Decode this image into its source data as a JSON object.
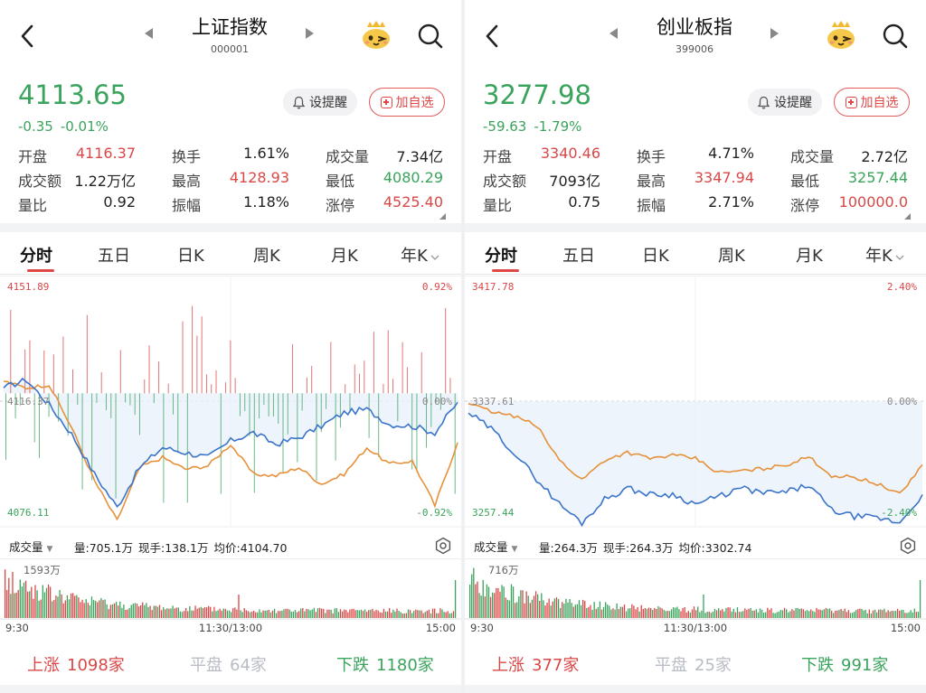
{
  "colors": {
    "up": "#d94747",
    "down": "#3aa35c",
    "price_line": "#3b74c8",
    "avg_line": "#e6913a",
    "flat": "#b8bcc4"
  },
  "icons": {
    "back": "chevron-left-icon",
    "prev": "triangle-left-icon",
    "next": "triangle-right-icon",
    "mascot": "mascot-icon",
    "search": "search-icon",
    "bell": "bell-icon",
    "add": "plus-box-icon",
    "gear": "gear-icon"
  },
  "buttons": {
    "alert_label": "设提醒",
    "add_label": "加自选"
  },
  "labels": {
    "open": "开盘",
    "turnover": "换手",
    "volume": "成交量",
    "amount": "成交额",
    "high": "最高",
    "low": "最低",
    "vol_ratio": "量比",
    "amplitude": "振幅",
    "limit_up": "涨停"
  },
  "tabs": [
    "分时",
    "五日",
    "日K",
    "周K",
    "月K",
    "年K"
  ],
  "axis_times": {
    "start": "9:30",
    "mid": "11:30/13:00",
    "end": "15:00"
  },
  "vol_dropdown_label": "成交量",
  "footer_labels": {
    "up": "上涨",
    "flat": "平盘",
    "down": "下跌"
  },
  "left": {
    "title": "上证指数",
    "code": "000001",
    "price": "4113.65",
    "change": "-0.35",
    "change_pct": "-0.01%",
    "stats": {
      "open": "4116.37",
      "turnover": "1.61%",
      "volume": "7.34亿",
      "amount": "1.22万亿",
      "high": "4128.93",
      "low": "4080.29",
      "vol_ratio": "0.92",
      "amplitude": "1.18%",
      "limit_up": "4525.40"
    },
    "axis": {
      "top_price": "4151.89",
      "top_pct": "0.92%",
      "mid_price": "4116.37",
      "mid_pct": "0.00%",
      "bottom_price": "4076.11",
      "bottom_pct": "-0.92%"
    },
    "vol_info": {
      "volume": "量:705.1万",
      "current": "现手:138.1万",
      "avg_price": "均价:4104.70"
    },
    "vol_max": "1593万",
    "footer": {
      "up": "1098家",
      "flat": "64家",
      "down": "1180家"
    }
  },
  "right": {
    "title": "创业板指",
    "code": "399006",
    "price": "3277.98",
    "change": "-59.63",
    "change_pct": "-1.79%",
    "stats": {
      "open": "3340.46",
      "turnover": "4.71%",
      "volume": "2.72亿",
      "amount": "7093亿",
      "high": "3347.94",
      "low": "3257.44",
      "vol_ratio": "0.75",
      "amplitude": "2.71%",
      "limit_up": "100000.0"
    },
    "axis": {
      "top_price": "3417.78",
      "top_pct": "2.40%",
      "mid_price": "3337.61",
      "mid_pct": "0.00%",
      "bottom_price": "3257.44",
      "bottom_pct": "-2.40%"
    },
    "vol_info": {
      "volume": "量:264.3万",
      "current": "现手:264.3万",
      "avg_price": "均价:3302.74"
    },
    "vol_max": "716万",
    "footer": {
      "up": "377家",
      "flat": "25家",
      "down": "991家"
    }
  },
  "chart_data": [
    {
      "type": "line",
      "title": "上证指数",
      "ylim": [
        4076.11,
        4151.89
      ],
      "prev_close": 4116.37,
      "x": [
        0,
        5,
        10,
        15,
        20,
        25,
        30,
        35,
        40,
        45,
        50,
        55,
        60,
        65,
        70,
        75,
        80,
        85,
        90,
        95,
        100
      ],
      "series": [
        {
          "values": [
            4118.0,
            4120.5,
            4113.0,
            4104.0,
            4092.0,
            4082.0,
            4094.0,
            4100.0,
            4098.5,
            4097.0,
            4102.0,
            4104.5,
            4101.0,
            4103.0,
            4106.5,
            4110.5,
            4111.5,
            4107.0,
            4106.5,
            4104.5,
            4113.65
          ]
        },
        {
          "values": [
            4120.0,
            4118.0,
            4119.0,
            4106.0,
            4090.0,
            4078.0,
            4094.0,
            4097.0,
            4093.5,
            4094.5,
            4101.0,
            4092.0,
            4091.5,
            4094.0,
            4089.0,
            4092.0,
            4100.0,
            4095.0,
            4096.0,
            4082.5,
            4101.5
          ]
        }
      ]
    },
    {
      "type": "line",
      "title": "创业板指",
      "ylim": [
        3257.44,
        3417.78
      ],
      "prev_close": 3337.61,
      "x": [
        0,
        5,
        10,
        15,
        20,
        25,
        30,
        35,
        40,
        45,
        50,
        55,
        60,
        65,
        70,
        75,
        80,
        85,
        90,
        95,
        100
      ],
      "series": [
        {
          "values": [
            3330.0,
            3320.0,
            3305.0,
            3288.0,
            3272.0,
            3260.0,
            3275.0,
            3282.0,
            3278.0,
            3278.0,
            3272.0,
            3276.5,
            3282.0,
            3279.0,
            3279.5,
            3284.0,
            3268.0,
            3264.0,
            3263.0,
            3260.0,
            3277.98
          ]
        },
        {
          "values": [
            3336.0,
            3331.0,
            3328.0,
            3322.0,
            3300.0,
            3287.5,
            3300.0,
            3305.0,
            3301.0,
            3303.0,
            3301.0,
            3292.0,
            3293.0,
            3294.5,
            3297.0,
            3302.0,
            3290.0,
            3289.0,
            3285.0,
            3278.0,
            3297.0
          ]
        }
      ]
    }
  ]
}
